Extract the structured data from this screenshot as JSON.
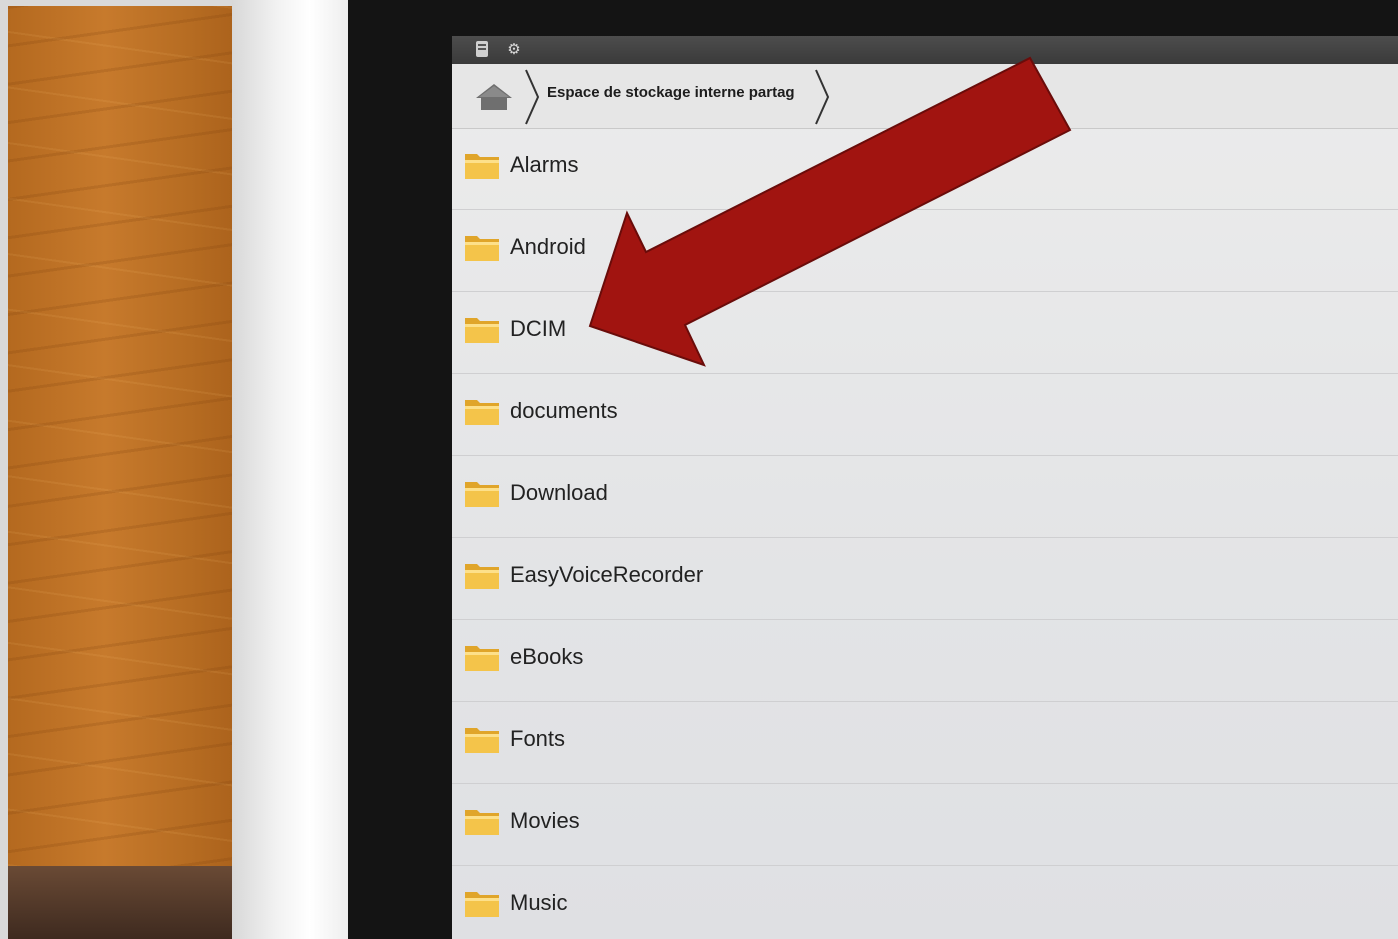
{
  "breadcrumb": {
    "home_icon": "home-icon",
    "path_label": "Espace de stockage interne partag"
  },
  "status": {
    "icons": [
      "sd-card-icon",
      "gear-icon"
    ]
  },
  "folders": [
    {
      "name": "Alarms"
    },
    {
      "name": "Android"
    },
    {
      "name": "DCIM"
    },
    {
      "name": "documents"
    },
    {
      "name": "Download"
    },
    {
      "name": "EasyVoiceRecorder"
    },
    {
      "name": "eBooks"
    },
    {
      "name": "Fonts"
    },
    {
      "name": "Movies"
    },
    {
      "name": "Music"
    }
  ],
  "annotation": {
    "arrow_color": "#a11410",
    "points_to": "DCIM"
  },
  "colors": {
    "folder_fill": "#f4c44a",
    "folder_tab": "#e0a52a"
  }
}
